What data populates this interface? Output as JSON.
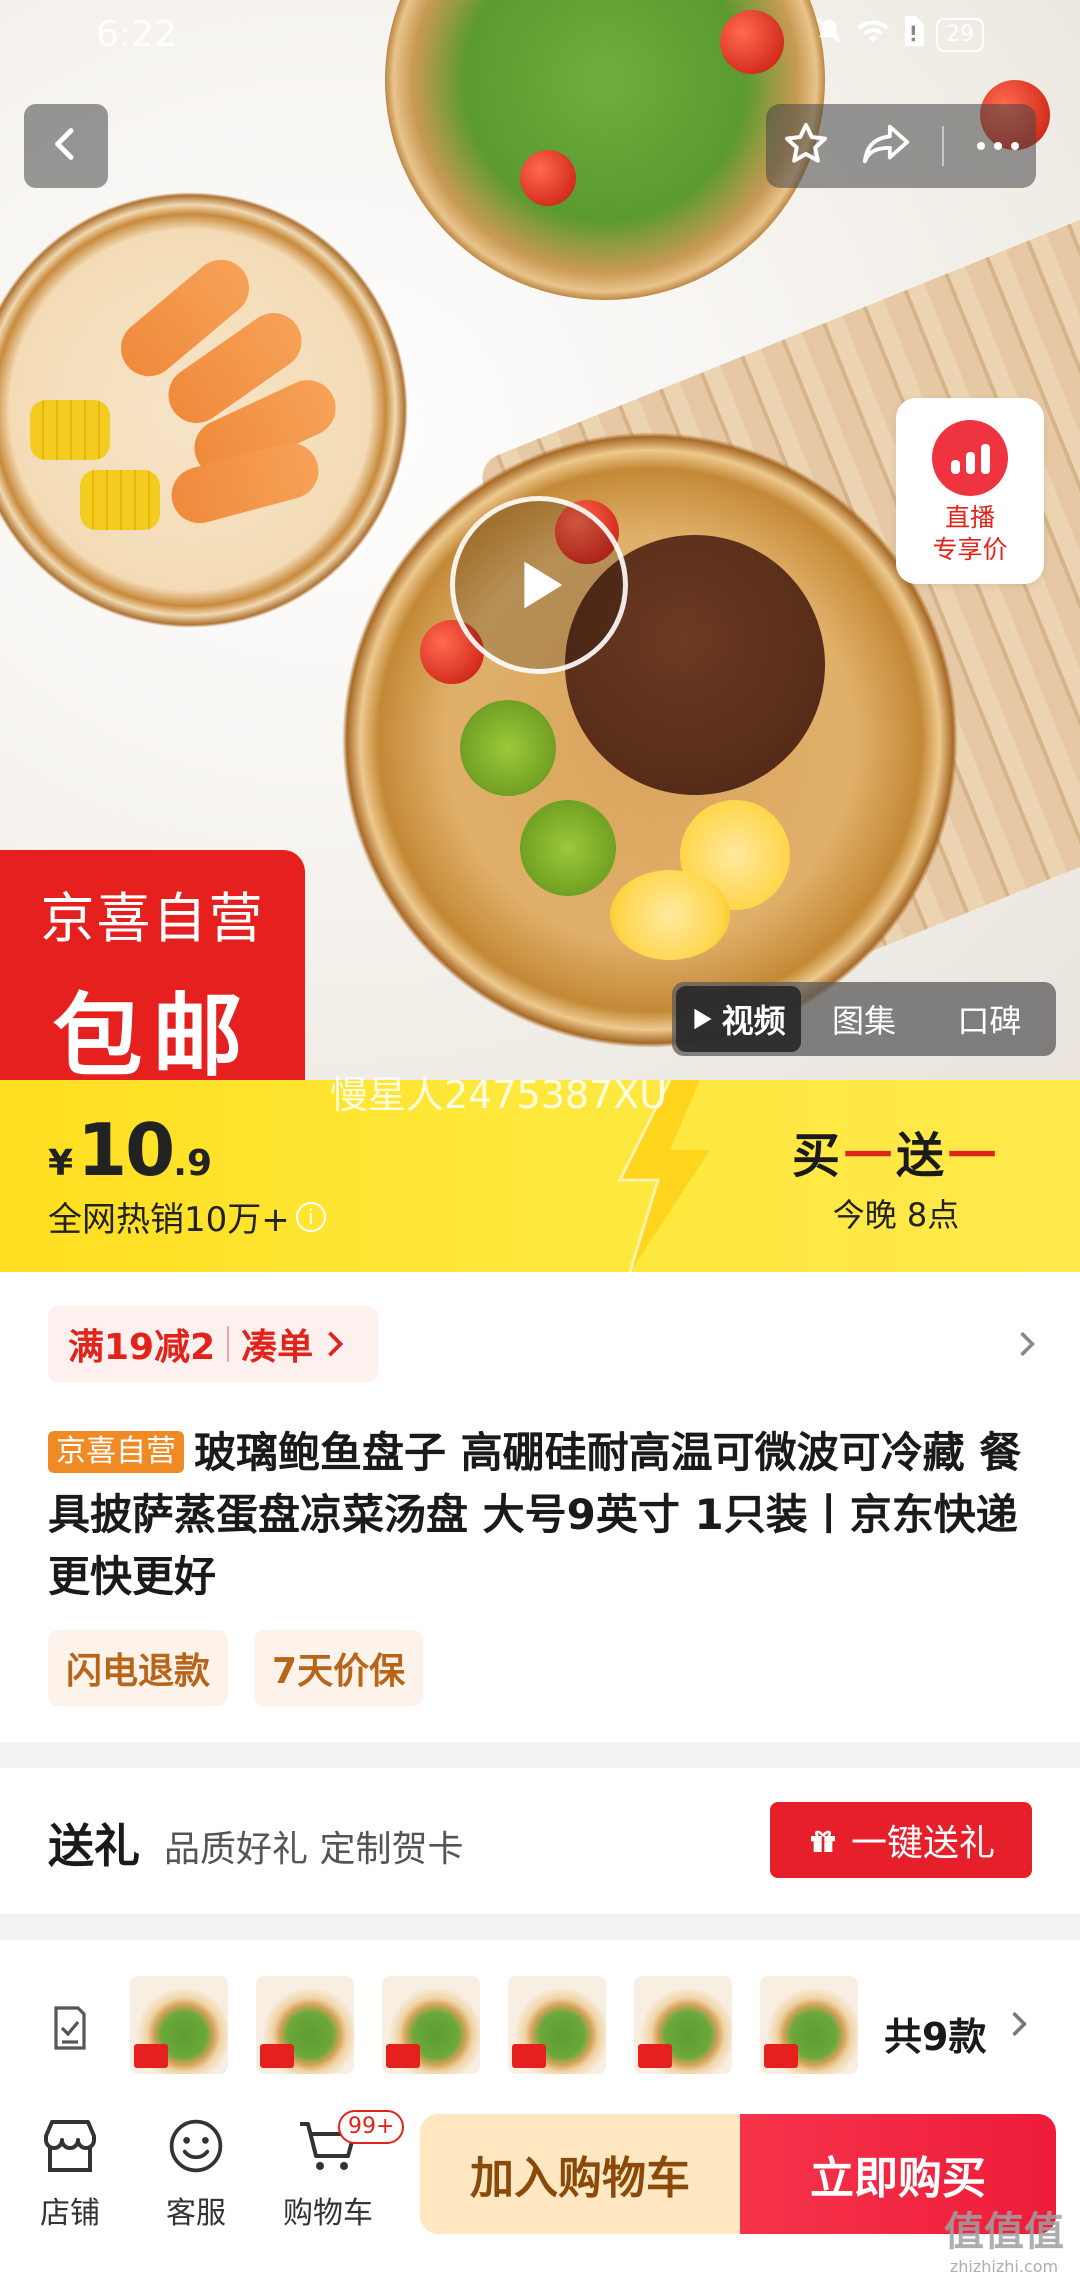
{
  "status_bar": {
    "time": "6:22",
    "battery": "29"
  },
  "hero": {
    "self_operated_badge_line1": "京喜自营",
    "self_operated_badge_line2": "包邮",
    "live_badge": {
      "line1": "直播",
      "line2": "专享价"
    },
    "media_tabs": [
      {
        "label": "视频",
        "active": true
      },
      {
        "label": "图集",
        "active": false
      },
      {
        "label": "口碑",
        "active": false
      }
    ]
  },
  "price_banner": {
    "currency": "¥",
    "price_int": "10",
    "price_dec": ".9",
    "hot_sales": "全网热销10万+",
    "watermark": "慢星人2475387XU",
    "promo": {
      "word1": "买",
      "dash1": "一",
      "word2": "送",
      "dash2": "一",
      "time": "今晚 8点"
    }
  },
  "coupon": {
    "discount": "满19减2",
    "action": "凑单"
  },
  "product": {
    "tag": "京喜自营",
    "title": "玻璃鲍鱼盘子 高硼硅耐高温可微波可冷藏 餐具披萨蒸蛋盘凉菜汤盘 大号9英寸 1只装丨京东快递 更快更好",
    "service_tags": [
      "闪电退款",
      "7天价保"
    ]
  },
  "gift": {
    "title": "送礼",
    "subtitle": "品质好礼 定制贺卡",
    "button": "一键送礼"
  },
  "variants": {
    "count_label": "共9款"
  },
  "bottom_bar": {
    "store": "店铺",
    "service": "客服",
    "cart": "购物车",
    "cart_badge": "99+",
    "add_to_cart": "加入购物车",
    "buy_now": "立即购买"
  },
  "site_watermark": {
    "big": "值值值",
    "small": "zhizhizhi.com"
  },
  "colors": {
    "accent_red": "#e2231a",
    "banner_yellow": "#ffe83a",
    "tag_orange": "#f08a24"
  }
}
